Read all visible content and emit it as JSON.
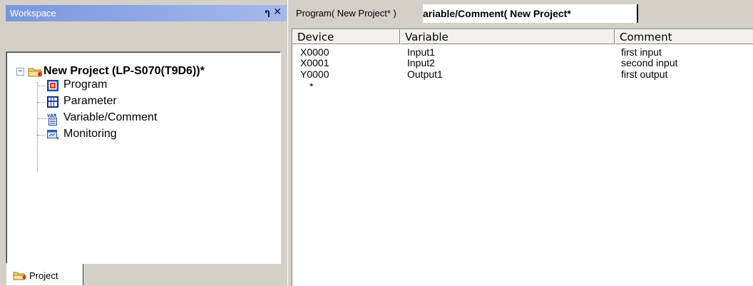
{
  "workspace": {
    "title": "Workspace",
    "pin_glyph": "ф",
    "close_glyph": "✕",
    "tree": {
      "root_label": "New Project (LP-S070(T9D6))*",
      "items": [
        {
          "label": "Program",
          "icon": "program-icon"
        },
        {
          "label": "Parameter",
          "icon": "parameter-icon"
        },
        {
          "label": "Variable/Comment",
          "icon": "variable-comment-icon"
        },
        {
          "label": "Monitoring",
          "icon": "monitoring-icon"
        }
      ]
    },
    "bottom_tab": {
      "label": "Project",
      "icon": "project-folder-icon"
    }
  },
  "editor": {
    "tabs": [
      {
        "label": "Program( New Project* )"
      },
      {
        "label": "ariable/Comment( New Project*",
        "active": true
      }
    ],
    "grid": {
      "columns": [
        "Device",
        "Variable",
        "Comment"
      ],
      "rows": [
        {
          "device": "X0000",
          "variable": "Input1",
          "comment": "first input"
        },
        {
          "device": "X0001",
          "variable": "Input2",
          "comment": "second input"
        },
        {
          "device": "Y0000",
          "variable": "Output1",
          "comment": "first output"
        }
      ],
      "new_row_marker": "*"
    }
  },
  "colors": {
    "title_gradient_start": "#7a96df",
    "title_gradient_end": "#a6b9ec",
    "panel_bg": "#d4d0c8"
  }
}
